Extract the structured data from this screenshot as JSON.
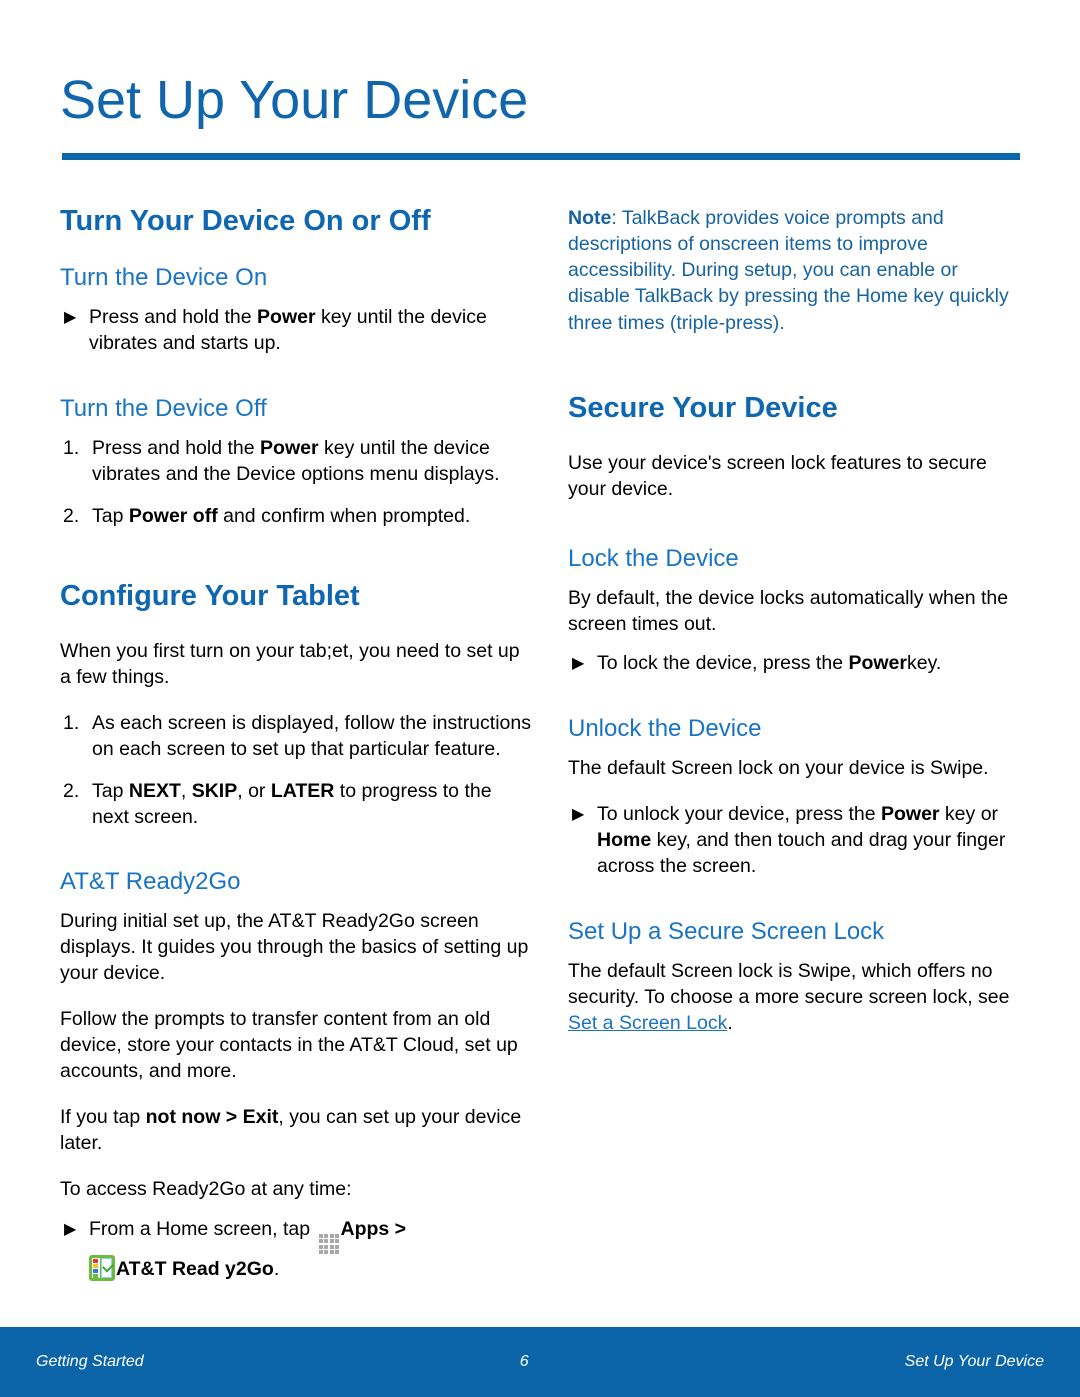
{
  "document": {
    "page_title": "Set Up Your Device",
    "accent_color": "#0d66ab",
    "heading_color": "#0f67b1",
    "subheading_color": "#1a74c4",
    "note_color": "#17639f",
    "footer_color": "#0b64a8"
  },
  "left_column": {
    "section1": {
      "heading": "Turn Your Device On or Off",
      "sub1": {
        "heading": "Turn the Device On",
        "bullet_marker": "▶",
        "bullet_lead": "Press and hold the ",
        "bullet_bold": "Power",
        "bullet_tail": " key until the device vibrates and starts up."
      },
      "sub2": {
        "heading": "Turn the Device Off",
        "steps": [
          {
            "number": "1.",
            "lead": "Press and hold the ",
            "bold": "Power",
            "tail": " key until the device vibrates and the Device options menu displays."
          },
          {
            "number": "2.",
            "lead": "Tap ",
            "bold": "Power off",
            "tail": " and confirm when prompted."
          }
        ]
      }
    },
    "section2": {
      "heading": "Configure Your Tablet",
      "intro": "When you first turn on your tab;et, you need to set up a few things.",
      "steps": [
        {
          "number": "1.",
          "text": "As each screen is displayed, follow the instructions on each screen to set up that particular feature."
        },
        {
          "number": "2.",
          "lead": "Tap ",
          "bold1": "NEXT",
          "mid1": ", ",
          "bold2": "SKIP",
          "mid2": ", or ",
          "bold3": "LATER",
          "tail": " to progress to the next screen."
        }
      ],
      "sub1": {
        "heading": "AT&T Ready2Go",
        "para1": "During initial set up, the AT&T Ready2Go screen displays. It guides you through the basics of setting up your device.",
        "para2": "Follow the prompts to transfer content from an old device, store your contacts in the AT&T Cloud, set up accounts, and more.",
        "para3_lead": "If you tap ",
        "para3_bold": "not now > Exit",
        "para3_tail": ", you can set up your device later.",
        "para4": "To access Ready2Go at any time:",
        "bullet_marker": "▶",
        "bullet_lead": "From a Home screen, tap ",
        "apps_icon_name": "apps-grid-icon",
        "bullet_apps_bold": "Apps >",
        "r2g_icon_name": "att-ready2go-icon",
        "bullet_app_bold": "AT&T Read y2Go",
        "bullet_tail": "."
      }
    }
  },
  "right_column": {
    "note": {
      "label": "Note",
      "separator": ": ",
      "text": "TalkBack provides voice prompts and descriptions of onscreen items to improve accessibility. During setup, you can enable or disable TalkBack by pressing the Home key quickly three times (triple-press)."
    },
    "section1": {
      "heading": "Secure Your Device",
      "intro": "Use your device's screen lock features to secure your device.",
      "sub1": {
        "heading": "Lock the Device",
        "para": "By default, the device locks automatically when the screen times out.",
        "bullet_marker": "▶",
        "bullet_lead": "To lock the device, press the ",
        "bullet_bold": "Power",
        "bullet_tail": "key."
      },
      "sub2": {
        "heading": "Unlock the Device",
        "para": "The default Screen lock on your device is Swipe.",
        "bullet_marker": "▶",
        "bullet_lead": "To unlock your device, press the ",
        "bullet_bold1": "Power",
        "bullet_mid": " key or ",
        "bullet_bold2": "Home",
        "bullet_tail": " key, and then touch and drag your finger across the screen."
      },
      "sub3": {
        "heading": "Set Up a Secure Screen Lock",
        "para_lead": "The default Screen lock is Swipe, which offers no security. To choose a more secure screen lock, see ",
        "link": "Set a Screen Lock",
        "para_tail": "."
      }
    }
  },
  "footer": {
    "left": "Getting Started",
    "page_number": "6",
    "right": "Set Up Your Device"
  }
}
